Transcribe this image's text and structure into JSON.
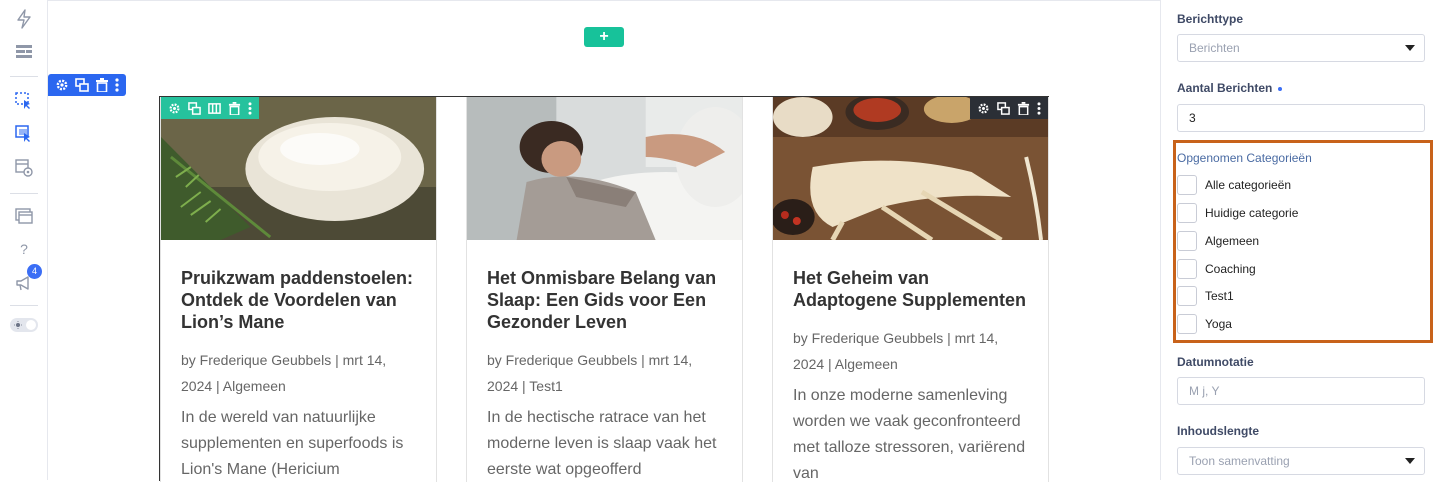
{
  "rail": {
    "badge_count": "4"
  },
  "canvas": {
    "add_label": "+",
    "posts": [
      {
        "title": "Pruikzwam paddenstoelen: Ontdek de Voordelen van Lion’s Mane",
        "meta": "by Frederique Geubbels | mrt 14, 2024 | Algemeen",
        "excerpt": "In de wereld van natuurlijke supplementen en superfoods is Lion's Mane (Hericium"
      },
      {
        "title": "Het Onmisbare Belang van Slaap: Een Gids voor Een Gezonder Leven",
        "meta": "by Frederique Geubbels | mrt 14, 2024 | Test1",
        "excerpt": "In de hectische ratrace van het moderne leven is slaap vaak het eerste wat opgeofferd"
      },
      {
        "title": "Het Geheim van Adaptogene Supplementen",
        "meta": "by Frederique Geubbels | mrt 14, 2024 | Algemeen",
        "excerpt": "In onze moderne samenleving worden we vaak geconfronteerd met talloze stressoren, variërend van"
      }
    ]
  },
  "panel": {
    "post_type": {
      "label": "Berichttype",
      "value": "Berichten"
    },
    "post_count": {
      "label": "Aantal Berichten",
      "value": "3"
    },
    "categories": {
      "label": "Opgenomen Categorieën",
      "items": [
        "Alle categorieën",
        "Huidige categorie",
        "Algemeen",
        "Coaching",
        "Test1",
        "Yoga"
      ]
    },
    "date_format": {
      "label": "Datumnotatie",
      "placeholder": "M j, Y"
    },
    "content_length": {
      "label": "Inhoudslengte",
      "value": "Toon samenvatting"
    }
  },
  "colors": {
    "accent": "#2b67f0",
    "add_green": "#17c29a",
    "highlight": "#c8621a"
  }
}
